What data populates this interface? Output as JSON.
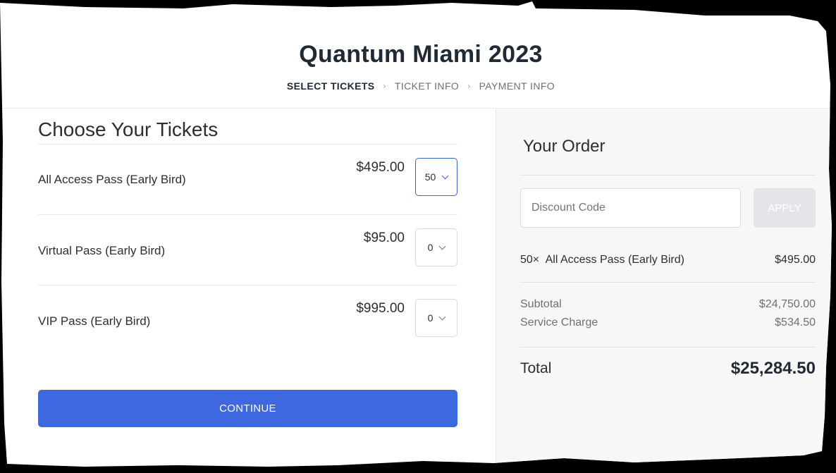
{
  "event": {
    "title": "Quantum Miami 2023",
    "steps": [
      {
        "label": "SELECT TICKETS"
      },
      {
        "label": "TICKET INFO"
      },
      {
        "label": "PAYMENT INFO"
      }
    ]
  },
  "tickets": {
    "heading": "Choose Your Tickets",
    "items": [
      {
        "name": "All Access Pass (Early Bird)",
        "price": "$495.00",
        "qty": "50"
      },
      {
        "name": "Virtual Pass (Early Bird)",
        "price": "$95.00",
        "qty": "0"
      },
      {
        "name": "VIP Pass (Early Bird)",
        "price": "$995.00",
        "qty": "0"
      }
    ],
    "continue_label": "CONTINUE"
  },
  "order": {
    "heading": "Your Order",
    "discount_placeholder": "Discount Code",
    "apply_label": "APPLY",
    "line_item": {
      "qty": "50×",
      "name": "All Access Pass (Early Bird)",
      "amount": "$495.00"
    },
    "subtotal_label": "Subtotal",
    "subtotal_value": "$24,750.00",
    "service_label": "Service Charge",
    "service_value": "$534.50",
    "total_label": "Total",
    "total_value": "$25,284.50"
  },
  "colors": {
    "accent": "#3e68e0",
    "focus": "#3a64d8",
    "panel": "#f7f7f7"
  }
}
